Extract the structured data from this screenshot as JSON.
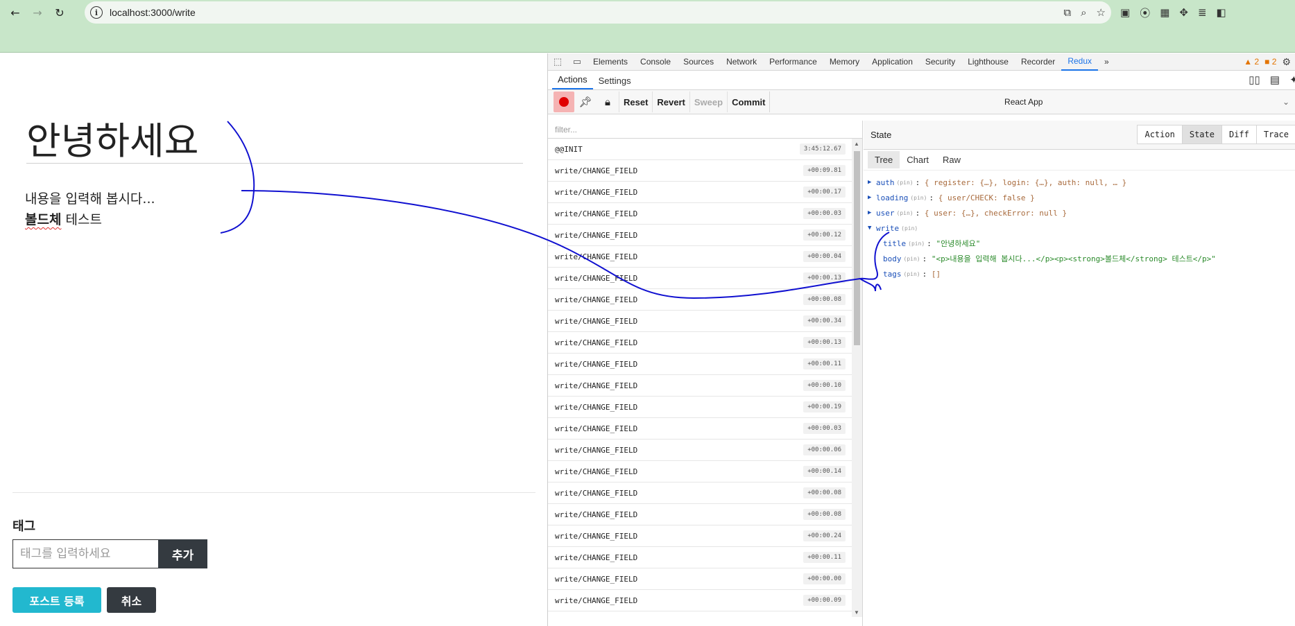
{
  "browser": {
    "url": "localhost:3000/write"
  },
  "app": {
    "title": "안녕하세요",
    "body_line1": "내용을 입력해 봅시다...",
    "body_bold": "볼드체",
    "body_rest": " 테스트",
    "tag_label": "태그",
    "tag_placeholder": "태그를 입력하세요",
    "tag_add": "추가",
    "post_button": "포스트 등록",
    "cancel_button": "취소"
  },
  "devtools": {
    "tabs": [
      "Elements",
      "Console",
      "Sources",
      "Network",
      "Performance",
      "Memory",
      "Application",
      "Security",
      "Lighthouse",
      "Recorder",
      "Redux"
    ],
    "more": "»",
    "warn_count": "2",
    "err_count": "2",
    "sub_tabs": [
      "Actions",
      "Settings"
    ],
    "toolbar": {
      "reset": "Reset",
      "revert": "Revert",
      "sweep": "Sweep",
      "commit": "Commit",
      "instance": "React App"
    },
    "filter_placeholder": "filter...",
    "actions": [
      {
        "name": "@@INIT",
        "time": "3:45:12.67"
      },
      {
        "name": "write/CHANGE_FIELD",
        "time": "+00:09.81"
      },
      {
        "name": "write/CHANGE_FIELD",
        "time": "+00:00.17"
      },
      {
        "name": "write/CHANGE_FIELD",
        "time": "+00:00.03"
      },
      {
        "name": "write/CHANGE_FIELD",
        "time": "+00:00.12"
      },
      {
        "name": "write/CHANGE_FIELD",
        "time": "+00:00.04"
      },
      {
        "name": "write/CHANGE_FIELD",
        "time": "+00:00.13"
      },
      {
        "name": "write/CHANGE_FIELD",
        "time": "+00:00.08"
      },
      {
        "name": "write/CHANGE_FIELD",
        "time": "+00:00.34"
      },
      {
        "name": "write/CHANGE_FIELD",
        "time": "+00:00.13"
      },
      {
        "name": "write/CHANGE_FIELD",
        "time": "+00:00.11"
      },
      {
        "name": "write/CHANGE_FIELD",
        "time": "+00:00.10"
      },
      {
        "name": "write/CHANGE_FIELD",
        "time": "+00:00.19"
      },
      {
        "name": "write/CHANGE_FIELD",
        "time": "+00:00.03"
      },
      {
        "name": "write/CHANGE_FIELD",
        "time": "+00:00.06"
      },
      {
        "name": "write/CHANGE_FIELD",
        "time": "+00:00.14"
      },
      {
        "name": "write/CHANGE_FIELD",
        "time": "+00:00.08"
      },
      {
        "name": "write/CHANGE_FIELD",
        "time": "+00:00.08"
      },
      {
        "name": "write/CHANGE_FIELD",
        "time": "+00:00.24"
      },
      {
        "name": "write/CHANGE_FIELD",
        "time": "+00:00.11"
      },
      {
        "name": "write/CHANGE_FIELD",
        "time": "+00:00.00"
      },
      {
        "name": "write/CHANGE_FIELD",
        "time": "+00:00.09"
      }
    ],
    "state": {
      "header": "State",
      "mode_tabs": [
        "Action",
        "State",
        "Diff",
        "Trace"
      ],
      "view_tabs": [
        "Tree",
        "Chart",
        "Raw"
      ],
      "pin": "(pin)",
      "auth_key": "auth",
      "auth_val": "{ register: {…}, login: {…}, auth: null, … }",
      "loading_key": "loading",
      "loading_val": "{ user/CHECK: false }",
      "user_key": "user",
      "user_val": "{ user: {…}, checkError: null }",
      "write_key": "write",
      "title_key": "title",
      "title_val": "\"안녕하세요\"",
      "body_key": "body",
      "body_val": "\"<p>내용을 입력해 봅시다...</p><p><strong>볼드체</strong> 테스트</p>\"",
      "tags_key": "tags",
      "tags_val": "[]"
    }
  },
  "colors": {
    "browser_green": "#c8e6c9",
    "cyan_button": "#22b8cf",
    "dark_button": "#343a40",
    "devtools_accent": "#1a73e8",
    "annotation_ink": "#1010d0"
  }
}
